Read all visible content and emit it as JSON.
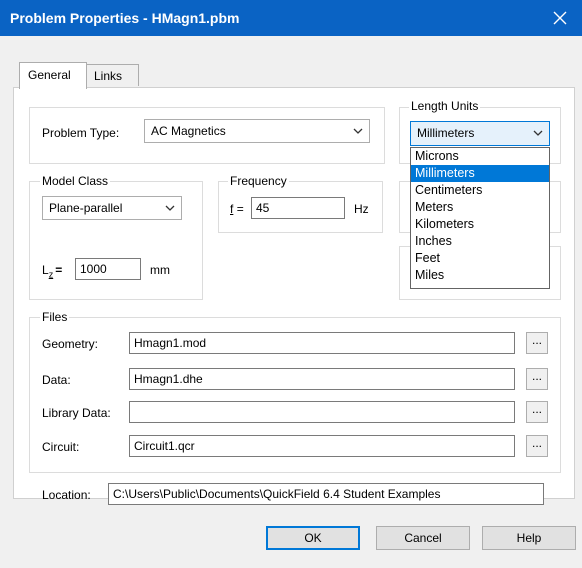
{
  "window": {
    "title": "Problem Properties - HMagn1.pbm"
  },
  "tabs": [
    {
      "label": "General"
    },
    {
      "label": "Links"
    }
  ],
  "problem_type": {
    "label": "Problem Type:",
    "value": "AC Magnetics"
  },
  "length_units": {
    "group_label": "Length Units",
    "value": "Millimeters",
    "options": [
      "Microns",
      "Millimeters",
      "Centimeters",
      "Meters",
      "Kilometers",
      "Inches",
      "Feet",
      "Miles"
    ],
    "selected_option": "Millimeters"
  },
  "model_class": {
    "group_label": "Model Class",
    "value": "Plane-parallel",
    "lz_label": "L",
    "lz_sub": "z",
    "lz_eq": "=",
    "lz_value": "1000",
    "lz_unit": "mm"
  },
  "frequency": {
    "group_label": "Frequency",
    "f_label": "f",
    "f_eq": "=",
    "value": "45",
    "unit": "Hz"
  },
  "files": {
    "group_label": "Files",
    "rows": [
      {
        "label": "Geometry:",
        "value": "Hmagn1.mod",
        "browse": "..."
      },
      {
        "label": "Data:",
        "value": "Hmagn1.dhe",
        "browse": "..."
      },
      {
        "label": "Library Data:",
        "value": "",
        "browse": "..."
      },
      {
        "label": "Circuit:",
        "value": "Circuit1.qcr",
        "browse": "..."
      }
    ]
  },
  "location": {
    "label": "Location:",
    "value": "C:\\Users\\Public\\Documents\\QuickField 6.4 Student Examples"
  },
  "buttons": {
    "ok": "OK",
    "cancel": "Cancel",
    "help": "Help"
  },
  "colors": {
    "titlebar": "#0a63c4",
    "selection": "#0078d7",
    "default_button_border": "#0078d7"
  }
}
